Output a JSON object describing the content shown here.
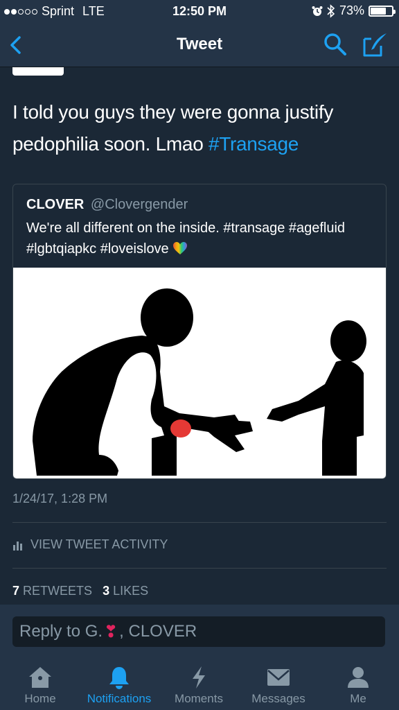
{
  "status_bar": {
    "carrier": "Sprint",
    "network": "LTE",
    "time": "12:50 PM",
    "battery": "73%",
    "battery_level": 0.73,
    "signal_bars": 2
  },
  "nav": {
    "title": "Tweet",
    "back_icon": "chevron-left-icon",
    "search_icon": "search-icon",
    "compose_icon": "compose-icon"
  },
  "tweet": {
    "text": "I told you guys they were gonna justify pedophilia soon. Lmao ",
    "hashtag": "#Transage",
    "quoted": {
      "name": "CLOVER",
      "handle": "@Clovergender",
      "text": "We're all different on the inside. #transage #agefluid #lgbtqiapkc #loveislove",
      "emoji": "rainbow-heart-icon"
    },
    "timestamp": "1/24/17, 1:28 PM",
    "activity_label": "VIEW TWEET ACTIVITY",
    "retweets_count": "7",
    "retweets_label": "RETWEETS",
    "likes_count": "3",
    "likes_label": "LIKES"
  },
  "reply": {
    "prefix": "Reply to G.",
    "suffix": ", CLOVER"
  },
  "tabs": [
    {
      "label": "Home",
      "icon": "home-icon"
    },
    {
      "label": "Notifications",
      "icon": "bell-icon"
    },
    {
      "label": "Moments",
      "icon": "lightning-icon"
    },
    {
      "label": "Messages",
      "icon": "envelope-icon"
    },
    {
      "label": "Me",
      "icon": "person-icon"
    }
  ],
  "colors": {
    "accent": "#1da1f2",
    "background": "#1b2836",
    "bar": "#243447",
    "muted": "#8899a6"
  }
}
